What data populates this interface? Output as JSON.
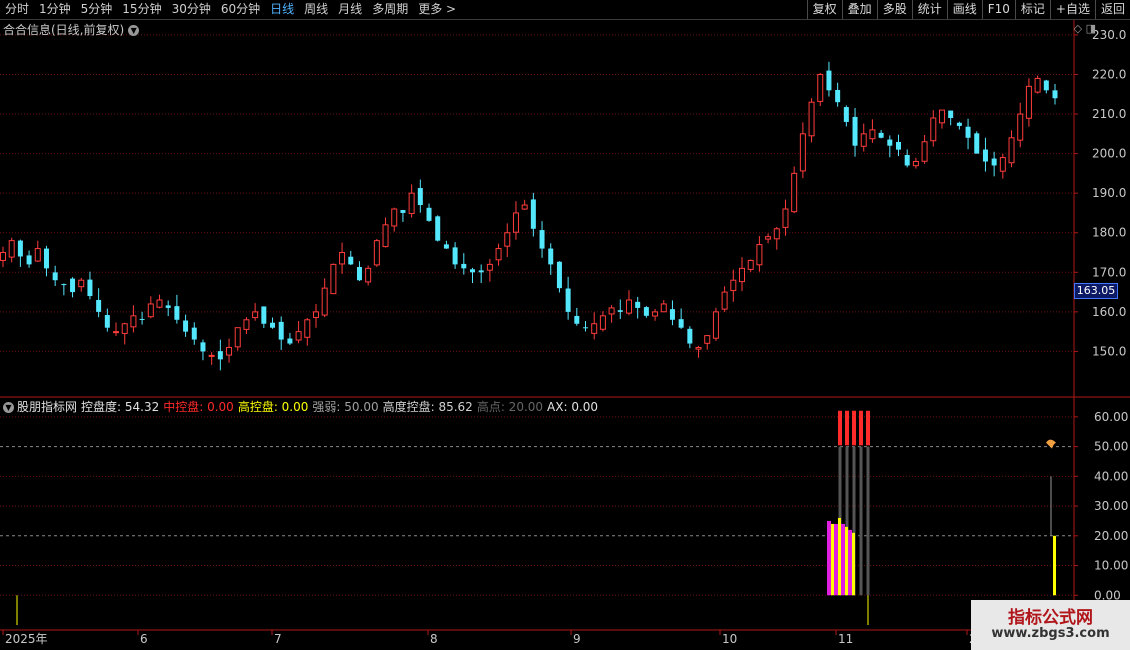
{
  "toolbar": {
    "periods": [
      "分时",
      "1分钟",
      "5分钟",
      "15分钟",
      "30分钟",
      "60分钟",
      "日线",
      "周线",
      "月线",
      "多周期",
      "更多 >"
    ],
    "active_period": "日线",
    "right_buttons": [
      "复权",
      "叠加",
      "多股",
      "统计",
      "画线",
      "F10",
      "标记",
      "+自选",
      "返回"
    ]
  },
  "main_pane": {
    "title": "合合信息(日线,前复权)",
    "current_price": "163.05"
  },
  "indicator": {
    "name": "股朋指标网",
    "items": [
      {
        "label": "控盘度:",
        "value": "54.32",
        "color": "#e0e0e0"
      },
      {
        "label": "中控盘:",
        "value": "0.00",
        "color": "#ff2a2a"
      },
      {
        "label": "高控盘:",
        "value": "0.00",
        "color": "#ffff00"
      },
      {
        "label": "强弱:",
        "value": "50.00",
        "color": "#a0a0a0"
      },
      {
        "label": "高度控盘:",
        "value": "85.62",
        "color": "#d0d0d0"
      },
      {
        "label": "高点:",
        "value": "20.00",
        "color": "#666666"
      },
      {
        "label": "AX:",
        "value": "0.00",
        "color": "#e0e0e0"
      }
    ]
  },
  "x_axis": [
    "2025年",
    "6",
    "7",
    "8",
    "9",
    "10",
    "11",
    "2"
  ],
  "watermark": {
    "line1": "指标公式网",
    "line2": "www.zbgs3.com"
  },
  "chart_data": [
    {
      "type": "candlestick",
      "title": "合合信息(日线,前复权)",
      "y_ticks": [
        150,
        160,
        170,
        180,
        190,
        200,
        210,
        220,
        230
      ],
      "ylim": [
        140,
        232
      ],
      "close_path": [
        175,
        178,
        174,
        172,
        176,
        171,
        168,
        167,
        165,
        168,
        164,
        160,
        156,
        155,
        157,
        159,
        158,
        162,
        163,
        161,
        158,
        155,
        153,
        150,
        149,
        148,
        151,
        156,
        158,
        160,
        157,
        156,
        153,
        152,
        155,
        158,
        160,
        166,
        172,
        175,
        172,
        168,
        171,
        178,
        182,
        186,
        185,
        190,
        187,
        183,
        178,
        176,
        172,
        171,
        170,
        170,
        172,
        176,
        180,
        185,
        187,
        181,
        176,
        172,
        166,
        160,
        157,
        156,
        157,
        159,
        161,
        160,
        163,
        161,
        159,
        160,
        162,
        158,
        156,
        152,
        151,
        154,
        160,
        165,
        168,
        171,
        173,
        177,
        179,
        181,
        186,
        195,
        205,
        213,
        220,
        216,
        213,
        208,
        202,
        205,
        206,
        204,
        202,
        201,
        197,
        198,
        203,
        209,
        211,
        209,
        207,
        204,
        200,
        198,
        197,
        199,
        204,
        210,
        217,
        219,
        216,
        214
      ],
      "last": 163.05
    },
    {
      "type": "bar",
      "title": "股朋指标网",
      "y_ticks": [
        0,
        10,
        20,
        30,
        40,
        50,
        60
      ],
      "ylim": [
        -10,
        65
      ],
      "series": [
        {
          "name": "控盘度",
          "color": "#e020e0",
          "values": [
            0,
            0,
            0,
            0,
            0,
            25,
            24,
            24,
            22,
            0
          ]
        },
        {
          "name": "高控盘",
          "color": "#ffff00",
          "values": [
            0,
            0,
            0,
            0,
            0,
            24,
            26,
            23,
            21,
            20
          ]
        },
        {
          "name": "中控盘",
          "color": "#ff2a2a",
          "values": [
            0,
            0,
            0,
            0,
            0,
            62,
            62,
            62,
            62,
            0
          ]
        }
      ]
    }
  ]
}
